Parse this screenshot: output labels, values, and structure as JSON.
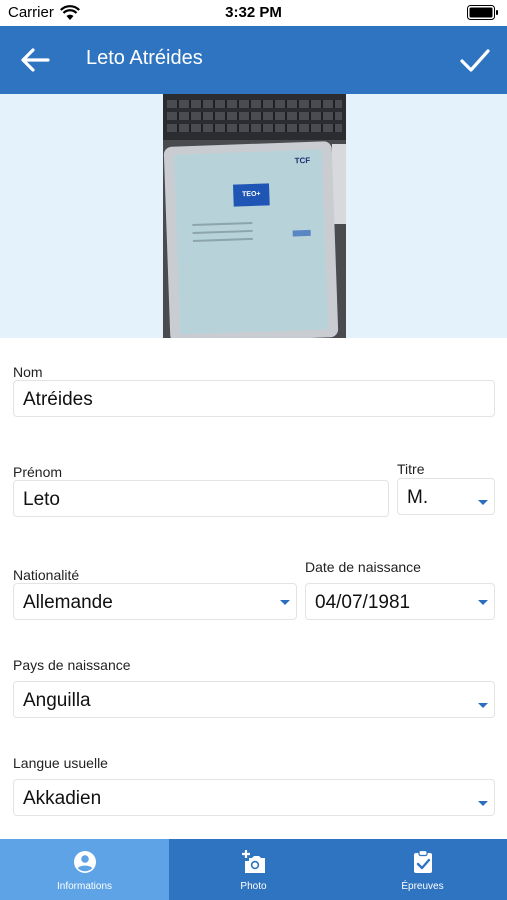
{
  "status_bar": {
    "carrier": "Carrier",
    "time": "3:32 PM"
  },
  "nav": {
    "title": "Leto Atréides"
  },
  "photo": {
    "teo_label": "TEO+",
    "tcf_label": "TCF"
  },
  "form": {
    "nom": {
      "label": "Nom",
      "value": "Atréides"
    },
    "prenom": {
      "label": "Prénom",
      "value": "Leto"
    },
    "titre": {
      "label": "Titre",
      "value": "M."
    },
    "nationalite": {
      "label": "Nationalité",
      "value": "Allemande"
    },
    "date_naissance": {
      "label": "Date de naissance",
      "value": "04/07/1981"
    },
    "pays_naissance": {
      "label": "Pays de naissance",
      "value": "Anguilla"
    },
    "langue_usuelle": {
      "label": "Langue usuelle",
      "value": "Akkadien"
    }
  },
  "tabs": [
    {
      "label": "Informations",
      "icon": "account-circle-icon",
      "active": true
    },
    {
      "label": "Photo",
      "icon": "add-photo-icon",
      "active": false
    },
    {
      "label": "Épreuves",
      "icon": "clipboard-check-icon",
      "active": false
    }
  ],
  "colors": {
    "primary": "#2f74c0",
    "tab_active": "#5ea3e6",
    "photo_background": "#e4f3fb",
    "caret": "#2a6ec0"
  }
}
